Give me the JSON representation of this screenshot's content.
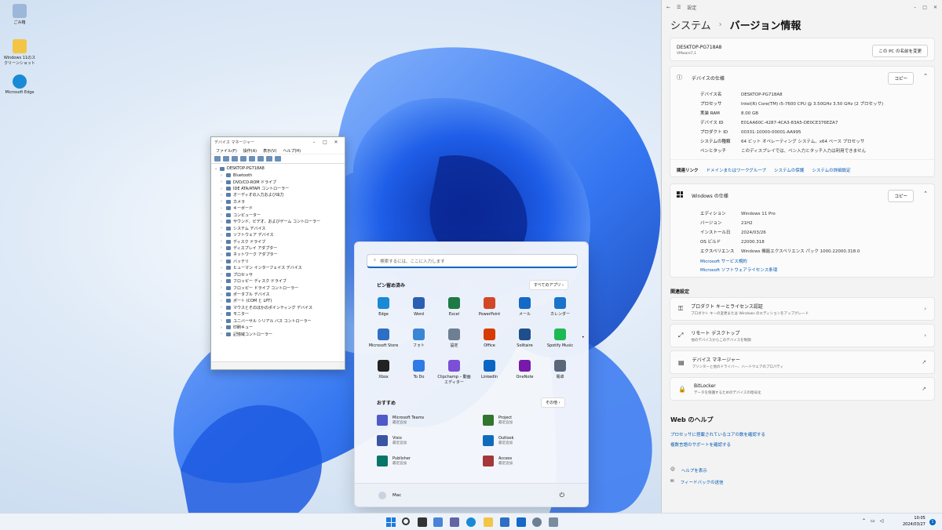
{
  "desktop": {
    "icons": [
      {
        "label": "ごみ箱"
      },
      {
        "label": "Windows 11のスクリーンショット"
      },
      {
        "label": "Microsoft Edge"
      }
    ]
  },
  "device_manager": {
    "title": "デバイス マネージャー",
    "menus": [
      "ファイル(F)",
      "操作(A)",
      "表示(V)",
      "ヘルプ(H)"
    ],
    "root": "DESKTOP-PG718A8",
    "items": [
      "Bluetooth",
      "DVD/CD-ROM ドライブ",
      "IDE ATA/ATAPI コントローラー",
      "オーディオの入力および出力",
      "カメラ",
      "キーボード",
      "コンピューター",
      "サウンド、ビデオ、およびゲーム コントローラー",
      "システム デバイス",
      "ソフトウェア デバイス",
      "ディスク ドライブ",
      "ディスプレイ アダプター",
      "ネットワーク アダプター",
      "バッテリ",
      "ヒューマン インターフェイス デバイス",
      "プロセッサ",
      "フロッピー ディスク ドライブ",
      "フロッピー ドライブ コントローラー",
      "ポータブル デバイス",
      "ポート (COM と LPT)",
      "マウスとそのほかのポインティング デバイス",
      "モニター",
      "ユニバーサル シリアル バス コントローラー",
      "印刷キュー",
      "記憶域コントローラー"
    ]
  },
  "start_menu": {
    "search_placeholder": "検索するには、ここに入力します",
    "pinned_title": "ピン留め済み",
    "all_apps": "すべてのアプリ  ›",
    "pinned": [
      {
        "label": "Edge",
        "color": "#1a8ad4"
      },
      {
        "label": "Word",
        "color": "#2b5fb4"
      },
      {
        "label": "Excel",
        "color": "#1d7a45"
      },
      {
        "label": "PowerPoint",
        "color": "#d24726"
      },
      {
        "label": "メール",
        "color": "#1569c7"
      },
      {
        "label": "カレンダー",
        "color": "#1a73c9"
      },
      {
        "label": "Microsoft Store",
        "color": "#2d6fc4"
      },
      {
        "label": "フォト",
        "color": "#3a86d4"
      },
      {
        "label": "設定",
        "color": "#6e7f92"
      },
      {
        "label": "Office",
        "color": "#d83b01"
      },
      {
        "label": "Solitaire",
        "color": "#1f4f8a"
      },
      {
        "label": "Spotify Music",
        "color": "#1db954"
      },
      {
        "label": "Xbox",
        "color": "#222222"
      },
      {
        "label": "To Do",
        "color": "#2f7ae5"
      },
      {
        "label": "Clipchamp – 動画エディター",
        "color": "#7b4fd6"
      },
      {
        "label": "LinkedIn",
        "color": "#0a66c2"
      },
      {
        "label": "OneNote",
        "color": "#7719aa"
      },
      {
        "label": "電卓",
        "color": "#5a6778"
      }
    ],
    "recommended_title": "おすすめ",
    "more": "その他  ›",
    "recommended": [
      {
        "name": "Microsoft Teams",
        "sub": "最近追加",
        "color": "#5059c9"
      },
      {
        "name": "Project",
        "sub": "最近追加",
        "color": "#31752f"
      },
      {
        "name": "Visio",
        "sub": "最近追加",
        "color": "#3955a3"
      },
      {
        "name": "Outlook",
        "sub": "最近追加",
        "color": "#0f6cbd"
      },
      {
        "name": "Publisher",
        "sub": "最近追加",
        "color": "#077568"
      },
      {
        "name": "Access",
        "sub": "最近追加",
        "color": "#a4373a"
      }
    ],
    "user": "Mac"
  },
  "settings": {
    "window_title": "設定",
    "breadcrumb_parent": "システム",
    "breadcrumb_sep": "›",
    "breadcrumb_current": "バージョン情報",
    "device_name": "DESKTOP-PG718A8",
    "device_model": "VMware7,1",
    "rename_button": "この PC の名前を変更",
    "device_spec_title": "デバイスの仕様",
    "copy": "コピー",
    "device_specs": [
      {
        "k": "デバイス名",
        "v": "DESKTOP-PG718A8"
      },
      {
        "k": "プロセッサ",
        "v": "Intel(R) Core(TM) i5-7600 CPU @ 3.50GHz   3.50 GHz (2 プロセッサ)"
      },
      {
        "k": "実装 RAM",
        "v": "8.00 GB"
      },
      {
        "k": "デバイス ID",
        "v": "E01AA60C-4287-4CA3-83A5-DE0CE376EZA7"
      },
      {
        "k": "プロダクト ID",
        "v": "00331-10000-00001-AA995"
      },
      {
        "k": "システムの種類",
        "v": "64 ビット オペレーティング システム、x64 ベース プロセッサ"
      },
      {
        "k": "ペンとタッチ",
        "v": "このディスプレイでは、ペン入力とタッチ入力は利用できません"
      }
    ],
    "related_links_label": "関連リンク",
    "related_links": [
      "ドメインまたはワークグループ",
      "システムの保護",
      "システムの詳細設定"
    ],
    "windows_spec_title": "Windows の仕様",
    "windows_specs": [
      {
        "k": "エディション",
        "v": "Windows 11 Pro"
      },
      {
        "k": "バージョン",
        "v": "21H2"
      },
      {
        "k": "インストール日",
        "v": "2024/03/26"
      },
      {
        "k": "OS ビルド",
        "v": "22000.318"
      },
      {
        "k": "エクスペリエンス",
        "v": "Windows 機能エクスペリエンス パック 1000.22000.318.0"
      }
    ],
    "service_agreement": "Microsoft サービス規約",
    "license_terms": "Microsoft ソフトウェアライセンス条項",
    "related_settings_title": "関連設定",
    "related_settings": [
      {
        "t": "プロダクト キーとライセンス認証",
        "s": "プロダクト キーの変更または Windows のエディションをアップグレード",
        "chev": "›"
      },
      {
        "t": "リモート デスクトップ",
        "s": "他のデバイスからこのデバイスを制御",
        "chev": "›"
      },
      {
        "t": "デバイス マネージャー",
        "s": "プリンターと他のドライバー、ハードウェアのプロパティ",
        "chev": "↗"
      },
      {
        "t": "BitLocker",
        "s": "データを保護するためのデバイスの暗号化",
        "chev": "↗"
      }
    ],
    "web_help_title": "Web のヘルプ",
    "web_help_links": [
      "プロセッサに搭載されているコアの数を確認する",
      "複数言語のサポートを確認する"
    ],
    "get_help": "ヘルプを表示",
    "feedback": "フィードバックの送信"
  },
  "taskbar": {
    "time": "10:05",
    "date": "2024/03/27",
    "badge": "1"
  }
}
